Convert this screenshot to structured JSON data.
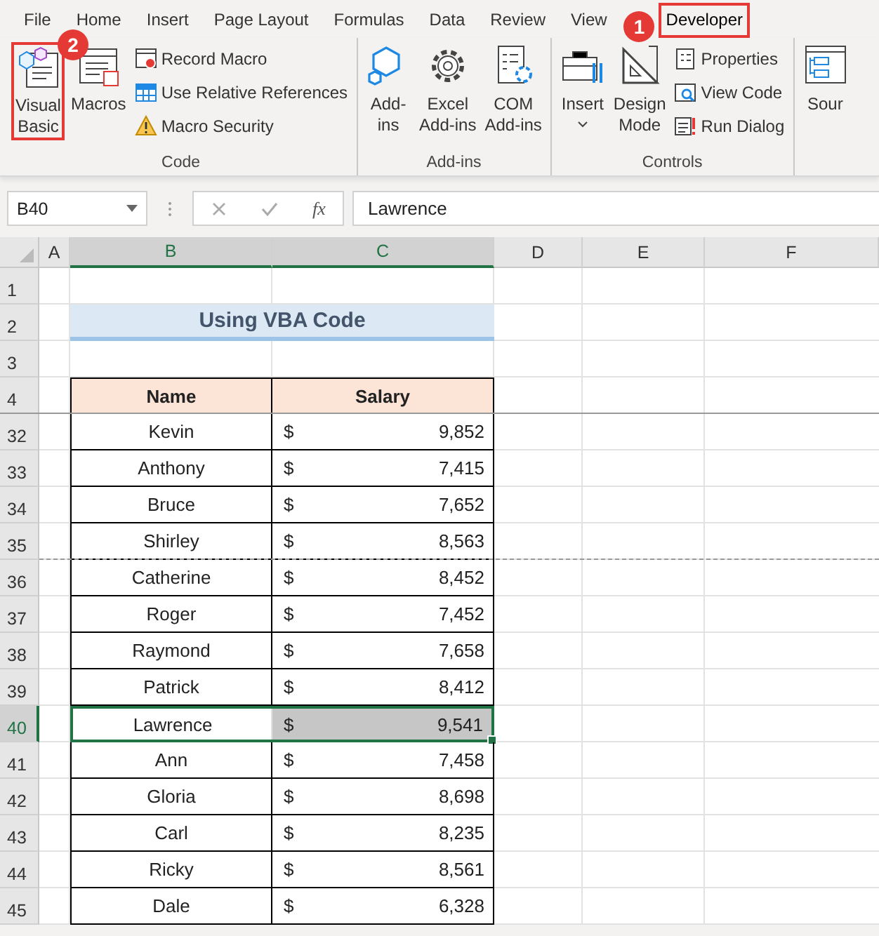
{
  "ribbon_tabs": [
    {
      "label": "File",
      "selected": false
    },
    {
      "label": "Home",
      "selected": false
    },
    {
      "label": "Insert",
      "selected": false
    },
    {
      "label": "Page Layout",
      "selected": false
    },
    {
      "label": "Formulas",
      "selected": false
    },
    {
      "label": "Data",
      "selected": false
    },
    {
      "label": "Review",
      "selected": false
    },
    {
      "label": "View",
      "selected": false
    },
    {
      "label": "Developer",
      "selected": true,
      "highlighted": true,
      "callout": "1"
    }
  ],
  "ribbon_groups": [
    {
      "label": "Code",
      "items": [
        {
          "kind": "large",
          "lines": [
            "Visual",
            "Basic"
          ],
          "highlighted": true,
          "callout": "2"
        },
        {
          "kind": "large",
          "lines": [
            "Macros"
          ]
        },
        {
          "kind": "small",
          "label": "Record Macro"
        },
        {
          "kind": "small",
          "label": "Use Relative References"
        },
        {
          "kind": "small",
          "label": "Macro Security"
        }
      ]
    },
    {
      "label": "Add-ins",
      "items": [
        {
          "kind": "large",
          "lines": [
            "Add-",
            "ins"
          ]
        },
        {
          "kind": "large",
          "lines": [
            "Excel",
            "Add-ins"
          ]
        },
        {
          "kind": "large",
          "lines": [
            "COM",
            "Add-ins"
          ]
        }
      ]
    },
    {
      "label": "Controls",
      "items": [
        {
          "kind": "large",
          "lines": [
            "Insert"
          ],
          "dropdown": true
        },
        {
          "kind": "large",
          "lines": [
            "Design",
            "Mode"
          ]
        },
        {
          "kind": "small",
          "label": "Properties"
        },
        {
          "kind": "small",
          "label": "View Code"
        },
        {
          "kind": "small",
          "label": "Run Dialog"
        }
      ]
    },
    {
      "items": [
        {
          "kind": "large",
          "lines": [
            "Sour"
          ]
        }
      ]
    }
  ],
  "formula_bar": {
    "name_box": "B40",
    "fx": "fx",
    "value": "Lawrence"
  },
  "columns": [
    {
      "label": "A",
      "selected": false
    },
    {
      "label": "B",
      "selected": true
    },
    {
      "label": "C",
      "selected": true
    },
    {
      "label": "D",
      "selected": false
    },
    {
      "label": "E",
      "selected": false
    },
    {
      "label": "F",
      "selected": false
    }
  ],
  "rows": [
    {
      "row": "1",
      "kind": "blank",
      "selected": false
    },
    {
      "row": "2",
      "kind": "title",
      "text": "Using VBA Code",
      "selected": false
    },
    {
      "row": "3",
      "kind": "blank",
      "selected": false
    },
    {
      "row": "4",
      "kind": "header",
      "name": "Name",
      "salary": "Salary",
      "selected": false
    },
    {
      "row": "32",
      "kind": "data",
      "name": "Kevin",
      "currency": "$",
      "amount": "9,852",
      "selected": false,
      "split_above": true
    },
    {
      "row": "33",
      "kind": "data",
      "name": "Anthony",
      "currency": "$",
      "amount": "7,415",
      "selected": false
    },
    {
      "row": "34",
      "kind": "data",
      "name": "Bruce",
      "currency": "$",
      "amount": "7,652",
      "selected": false
    },
    {
      "row": "35",
      "kind": "data",
      "name": "Shirley",
      "currency": "$",
      "amount": "8,563",
      "selected": false
    },
    {
      "row": "36",
      "kind": "data",
      "name": "Catherine",
      "currency": "$",
      "amount": "8,452",
      "selected": false,
      "page_break_above": true
    },
    {
      "row": "37",
      "kind": "data",
      "name": "Roger",
      "currency": "$",
      "amount": "7,452",
      "selected": false
    },
    {
      "row": "38",
      "kind": "data",
      "name": "Raymond",
      "currency": "$",
      "amount": "7,658",
      "selected": false
    },
    {
      "row": "39",
      "kind": "data",
      "name": "Patrick",
      "currency": "$",
      "amount": "8,412",
      "selected": false
    },
    {
      "row": "40",
      "kind": "data",
      "name": "Lawrence",
      "currency": "$",
      "amount": "9,541",
      "selected": true
    },
    {
      "row": "41",
      "kind": "data",
      "name": "Ann",
      "currency": "$",
      "amount": "7,458",
      "selected": false
    },
    {
      "row": "42",
      "kind": "data",
      "name": "Gloria",
      "currency": "$",
      "amount": "8,698",
      "selected": false
    },
    {
      "row": "43",
      "kind": "data",
      "name": "Carl",
      "currency": "$",
      "amount": "8,235",
      "selected": false
    },
    {
      "row": "44",
      "kind": "data",
      "name": "Ricky",
      "currency": "$",
      "amount": "8,561",
      "selected": false
    },
    {
      "row": "45",
      "kind": "data",
      "name": "Dale",
      "currency": "$",
      "amount": "6,328",
      "selected": false
    }
  ]
}
